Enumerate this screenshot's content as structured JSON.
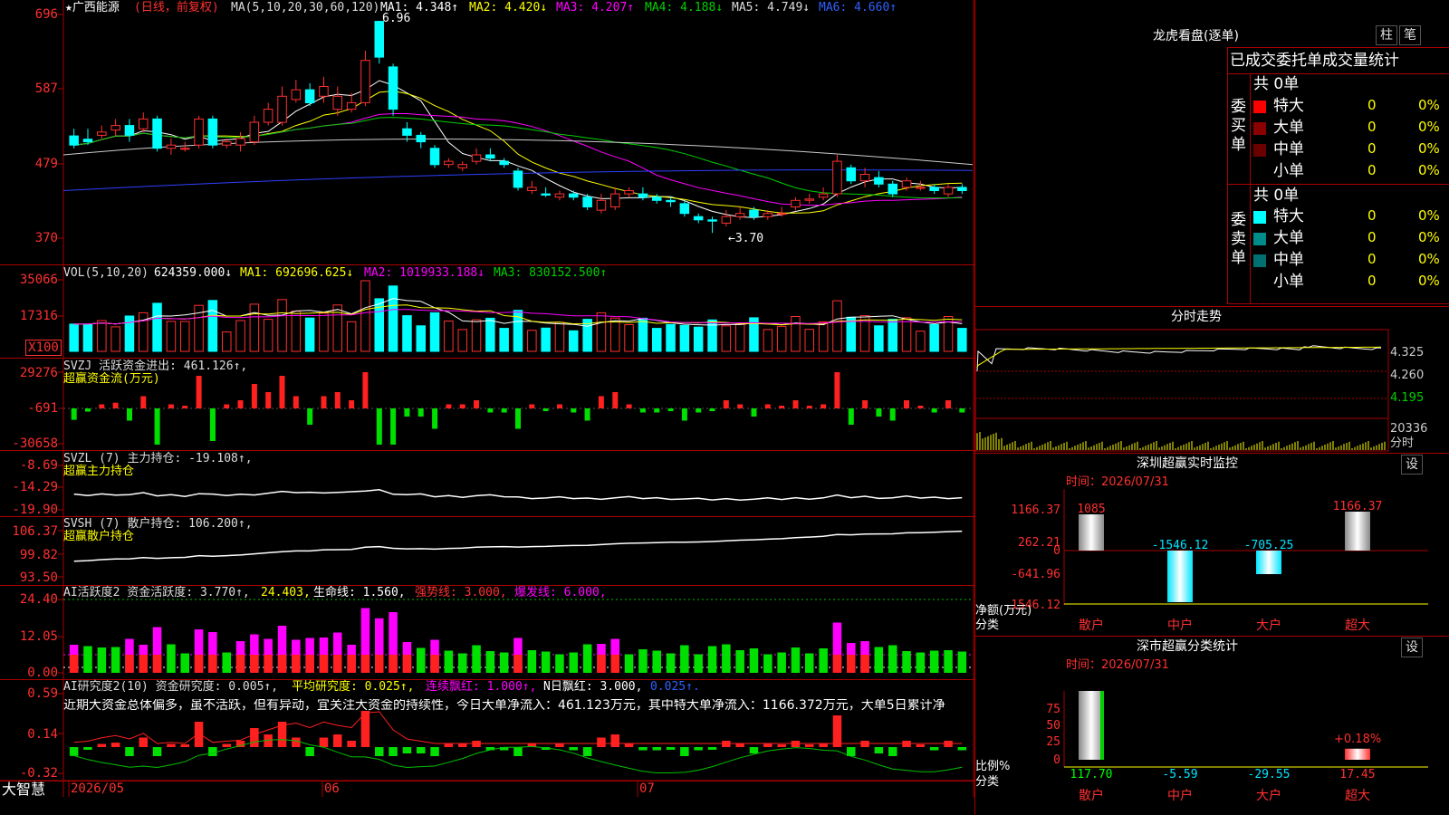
{
  "stock": {
    "title": "★广西能源",
    "period": "(日线，前复权)",
    "ma_label": "MA(5,10,20,30,60,120)",
    "ma1": "MA1: 4.348↑",
    "ma2": "MA2: 4.420↓",
    "ma3": "MA3: 4.207↑",
    "ma4": "MA4: 4.188↓",
    "ma5": "MA5: 4.749↓",
    "ma6": "MA6: 4.660↑",
    "high_mark": "6.96",
    "low_mark": "←3.70",
    "y_ticks": [
      "696",
      "587",
      "479",
      "370"
    ]
  },
  "volume": {
    "label": "VOL(5,10,20)",
    "value": "624359.000↓",
    "ma1": "MA1: 692696.625↓",
    "ma2": "MA2: 1019933.188↓",
    "ma3": "MA3: 830152.500↑",
    "y_ticks": [
      "35066",
      "17316"
    ],
    "unit": "X100"
  },
  "svzj": {
    "label": "SVZJ  活跃资金进出: 461.126↑,",
    "sub": "超赢资金流(万元)",
    "y_ticks": [
      "29276",
      "-691",
      "-30658"
    ]
  },
  "svzl": {
    "label": "SVZL (7) 主力持仓: -19.108↑,",
    "sub": "超赢主力持仓",
    "y_ticks": [
      "-8.69",
      "-14.29",
      "-19.90"
    ]
  },
  "svsh": {
    "label": "SVSH (7) 散户持仓: 106.200↑,",
    "sub": "超赢散户持仓",
    "y_ticks": [
      "106.37",
      "99.82",
      "93.50"
    ]
  },
  "ai_active": {
    "label": "AI活跃度2 资金活跃度: 3.770↑,",
    "v1": "24.403,",
    "v2": "生命线: 1.560,",
    "v3": "强势线: 3.000,",
    "v4": "爆发线: 6.000,",
    "y_ticks": [
      "24.40",
      "12.05",
      "0.00"
    ]
  },
  "ai_research": {
    "label": "AI研究度2(10) 资金研究度: 0.005↑,",
    "v1": "平均研究度: 0.025↑,",
    "v2": "连续飘红: 1.000↑,",
    "v3": "N日飘红: 3.000,",
    "v4": "0.025↑.",
    "comment": "近期大资金总体偏多，虽不活跃，但有异动，宜关注大资金的持续性，今日大单净流入：461.123万元，其中特大单净流入：1166.372万元，大单5日累计净",
    "y_ticks": [
      "0.59",
      "0.14",
      "-0.32"
    ]
  },
  "bottom_axis": {
    "brand": "大智慧",
    "dates": [
      "2026/05",
      "06",
      "07"
    ]
  },
  "right": {
    "dragon_title": "龙虎看盘(逐单)",
    "btn_zhu": "柱",
    "btn_bi": "笔",
    "stats_header": "已成交委托单成交量统计",
    "buy_group": "委买单",
    "buy_total": "共 0单",
    "sell_group": "委卖单",
    "sell_total": "共 0单",
    "rows": [
      {
        "name": "特大",
        "count": "0",
        "pct": "0%"
      },
      {
        "name": "大单",
        "count": "0",
        "pct": "0%"
      },
      {
        "name": "中单",
        "count": "0",
        "pct": "0%"
      },
      {
        "name": "小单",
        "count": "0",
        "pct": "0%"
      }
    ],
    "buy_colors": [
      "#ff0000",
      "#8b0000",
      "#6b0000",
      "#000000"
    ],
    "sell_colors": [
      "#00ffff",
      "#008b8b",
      "#007070",
      "#000000"
    ],
    "intraday_title": "分时走势",
    "intraday_ticks": [
      "4.325",
      "4.260",
      "4.195",
      "20336",
      "分时"
    ],
    "monitor_title": "深圳超赢实时监控",
    "monitor_btn": "设",
    "monitor_time": "时间：2026/07/31",
    "monitor_ticks": [
      "1166.37",
      "262.21",
      "0",
      "-641.96",
      "-1546.12"
    ],
    "monitor_axis_label": "净额(万元)",
    "monitor_axis_label2": "分类",
    "monitor_values": [
      {
        "cat": "散户",
        "value": 1085,
        "label": "1085"
      },
      {
        "cat": "中户",
        "value": -1546.12,
        "label": "-1546.12"
      },
      {
        "cat": "大户",
        "value": -705.25,
        "label": "-705.25"
      },
      {
        "cat": "超大",
        "value": 1166.37,
        "label": "1166.37"
      }
    ],
    "stat_title": "深市超赢分类统计",
    "stat_btn": "设",
    "stat_time": "时间：2026/07/31",
    "stat_ticks": [
      "75",
      "50",
      "25",
      "0"
    ],
    "stat_axis_label": "比例%",
    "stat_axis_label2": "分类",
    "stat_extra": "+0.18%",
    "stat_values": [
      {
        "cat": "散户",
        "value": 117.7,
        "label": "117.70"
      },
      {
        "cat": "中户",
        "value": -5.59,
        "label": "-5.59"
      },
      {
        "cat": "大户",
        "value": -29.55,
        "label": "-29.55"
      },
      {
        "cat": "超大",
        "value": 17.45,
        "label": "17.45"
      }
    ]
  },
  "colors": {
    "up": "#ff3030",
    "down": "#00ffff",
    "grid": "#aa0000",
    "yellow": "#ffff00",
    "magenta": "#ff00ff",
    "green": "#00d000"
  },
  "chart_data": {
    "type": "candlestick",
    "title": "广西能源 (日线，前复权)",
    "x_labels": [
      "2026/05",
      "06",
      "07"
    ],
    "ylim": [
      3.7,
      6.96
    ],
    "candles": [
      [
        5.19,
        5.05,
        5.3,
        5.0
      ],
      [
        5.14,
        5.1,
        5.3,
        5.05
      ],
      [
        5.2,
        5.25,
        5.35,
        5.15
      ],
      [
        5.28,
        5.35,
        5.45,
        5.2
      ],
      [
        5.35,
        5.2,
        5.45,
        5.1
      ],
      [
        5.3,
        5.45,
        5.55,
        5.25
      ],
      [
        5.45,
        5.0,
        5.5,
        4.95
      ],
      [
        5.0,
        5.05,
        5.15,
        4.9
      ],
      [
        5.0,
        5.0,
        5.1,
        4.95
      ],
      [
        5.05,
        5.45,
        5.5,
        5.0
      ],
      [
        5.45,
        5.05,
        5.5,
        5.0
      ],
      [
        5.05,
        5.1,
        5.15,
        5.0
      ],
      [
        5.05,
        5.15,
        5.25,
        4.95
      ],
      [
        5.1,
        5.4,
        5.5,
        5.05
      ],
      [
        5.4,
        5.6,
        5.7,
        5.35
      ],
      [
        5.4,
        5.8,
        5.95,
        5.35
      ],
      [
        5.75,
        5.9,
        6.05,
        5.7
      ],
      [
        5.9,
        5.7,
        6.0,
        5.65
      ],
      [
        5.8,
        5.95,
        6.1,
        5.7
      ],
      [
        5.6,
        5.8,
        5.95,
        5.5
      ],
      [
        5.6,
        5.7,
        5.85,
        5.55
      ],
      [
        5.7,
        6.35,
        6.5,
        5.65
      ],
      [
        6.95,
        6.4,
        6.96,
        6.3
      ],
      [
        6.25,
        5.6,
        6.3,
        5.5
      ],
      [
        5.3,
        5.2,
        5.4,
        5.1
      ],
      [
        5.2,
        5.1,
        5.25,
        5.0
      ],
      [
        5.0,
        4.75,
        5.05,
        4.7
      ],
      [
        4.75,
        4.8,
        4.85,
        4.7
      ],
      [
        4.7,
        4.75,
        4.8,
        4.65
      ],
      [
        4.8,
        4.9,
        5.0,
        4.75
      ],
      [
        4.9,
        4.85,
        5.0,
        4.8
      ],
      [
        4.8,
        4.75,
        4.85,
        4.7
      ],
      [
        4.65,
        4.4,
        4.7,
        4.35
      ],
      [
        4.35,
        4.4,
        4.5,
        4.3
      ],
      [
        4.3,
        4.28,
        4.4,
        4.25
      ],
      [
        4.25,
        4.3,
        4.35,
        4.2
      ],
      [
        4.3,
        4.25,
        4.35,
        4.2
      ],
      [
        4.25,
        4.1,
        4.3,
        4.05
      ],
      [
        4.05,
        4.2,
        4.3,
        4.0
      ],
      [
        4.1,
        4.3,
        4.4,
        4.05
      ],
      [
        4.3,
        4.35,
        4.4,
        4.25
      ],
      [
        4.3,
        4.25,
        4.4,
        4.2
      ],
      [
        4.25,
        4.2,
        4.3,
        4.15
      ],
      [
        4.2,
        4.18,
        4.25,
        4.1
      ],
      [
        4.15,
        4.0,
        4.2,
        3.95
      ],
      [
        3.95,
        3.9,
        4.0,
        3.85
      ],
      [
        3.9,
        3.88,
        3.95,
        3.7
      ],
      [
        3.85,
        3.95,
        4.05,
        3.8
      ],
      [
        3.95,
        4.0,
        4.1,
        3.9
      ],
      [
        4.05,
        3.95,
        4.1,
        3.9
      ],
      [
        3.95,
        4.0,
        4.05,
        3.9
      ],
      [
        4.0,
        4.0,
        4.1,
        3.95
      ],
      [
        4.1,
        4.2,
        4.25,
        4.05
      ],
      [
        4.2,
        4.22,
        4.3,
        4.15
      ],
      [
        4.25,
        4.3,
        4.4,
        4.2
      ],
      [
        4.3,
        4.8,
        4.9,
        4.25
      ],
      [
        4.7,
        4.5,
        4.75,
        4.45
      ],
      [
        4.5,
        4.6,
        4.7,
        4.4
      ],
      [
        4.55,
        4.45,
        4.65,
        4.4
      ],
      [
        4.45,
        4.3,
        4.5,
        4.25
      ],
      [
        4.4,
        4.5,
        4.55,
        4.35
      ],
      [
        4.4,
        4.4,
        4.5,
        4.35
      ],
      [
        4.4,
        4.35,
        4.45,
        4.3
      ],
      [
        4.3,
        4.4,
        4.45,
        4.25
      ],
      [
        4.4,
        4.35,
        4.45,
        4.3
      ]
    ]
  }
}
